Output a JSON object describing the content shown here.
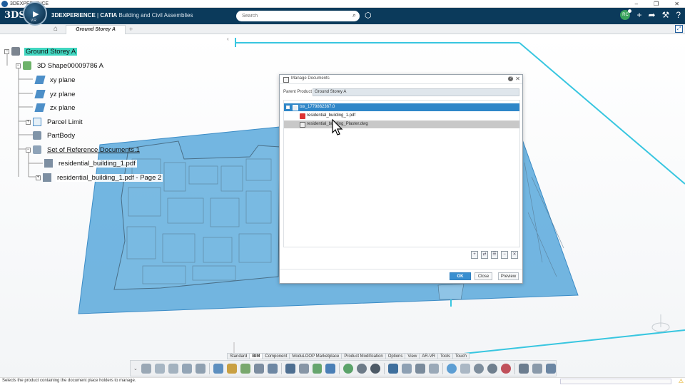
{
  "window": {
    "title": "3DEXPERIENCE",
    "minimize": "–",
    "maximize": "❐",
    "close": "✕"
  },
  "topbar": {
    "ds_logo": "3DS",
    "compass_version": "V.R",
    "brand_name": "3DEXPERIENCE",
    "app_name": "CATIA",
    "app_subtitle": "Building and Civil Assemblies",
    "search_placeholder": "Search",
    "avatar_initials": "RC"
  },
  "tabs": {
    "active_tab": "Ground Storey A",
    "add_label": "+"
  },
  "tree": {
    "root": "Ground Storey A",
    "shape": "3D Shape00009786 A",
    "plane_xy": "xy plane",
    "plane_yz": "yz plane",
    "plane_zx": "zx plane",
    "parcel": "Parcel Limit",
    "partbody": "PartBody",
    "refdocs": "Set of Reference Documents.1",
    "doc1": "residential_building_1.pdf",
    "doc2": "residential_building_1.pdf - Page 2"
  },
  "dialog": {
    "title": "Manage Documents",
    "parent_product_label": "Parent Product",
    "parent_product_value": "Ground Storey A",
    "rows": [
      {
        "label": "txx_1779862367.0"
      },
      {
        "label": "residential_building_1.pdf"
      },
      {
        "label": "residential_building_Plaster.dwg"
      }
    ],
    "ok_label": "OK",
    "close_label": "Close",
    "preview_label": "Preview"
  },
  "action_tabs": [
    "Standard",
    "BIM",
    "Component",
    "ModuLOOP Marketplace",
    "Product Modification",
    "Options",
    "View",
    "AR-VR",
    "Tools",
    "Touch"
  ],
  "status": {
    "text": "Selects the product containing the document place holders to manage."
  },
  "colors": {
    "topbar": "#0b3a5b",
    "tree_highlight": "#40d6c0",
    "selection": "#2e86c8",
    "plane_fill": "#5aa9dc"
  }
}
